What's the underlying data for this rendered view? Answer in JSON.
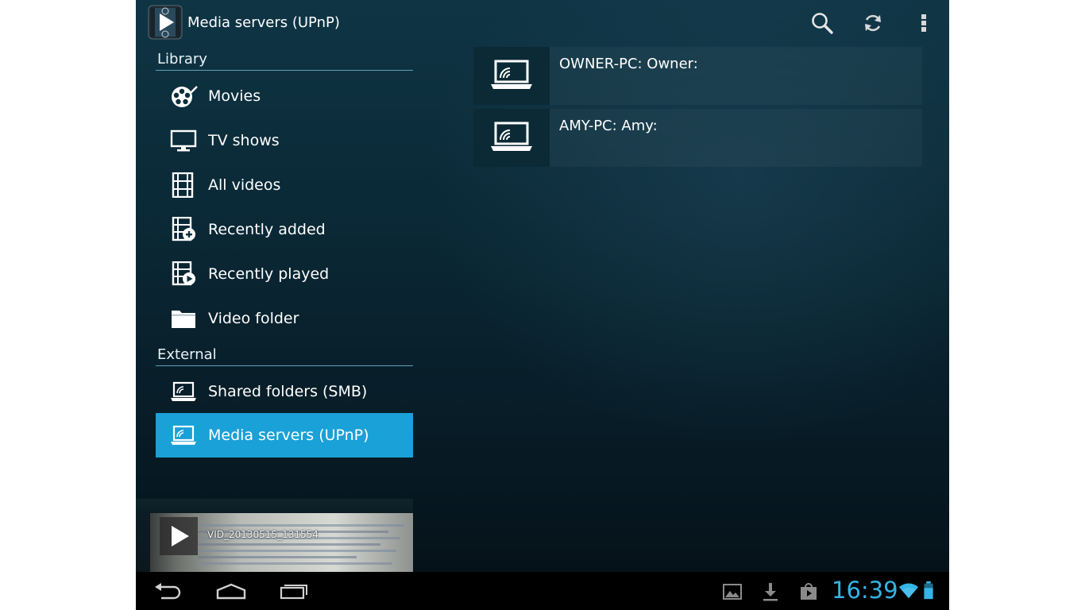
{
  "app": {
    "title": "Media servers (UPnP)"
  },
  "actionbar": {
    "actions": [
      {
        "name": "search",
        "icon": "search-icon"
      },
      {
        "name": "refresh",
        "icon": "refresh-icon"
      },
      {
        "name": "overflow",
        "icon": "overflow-menu-icon"
      }
    ]
  },
  "drawer": {
    "library_header": "Library",
    "library_items": [
      {
        "label": "Movies",
        "icon": "movies-reel-icon"
      },
      {
        "label": "TV shows",
        "icon": "tv-icon"
      },
      {
        "label": "All videos",
        "icon": "film-strip-icon"
      },
      {
        "label": "Recently added",
        "icon": "film-add-icon"
      },
      {
        "label": "Recently played",
        "icon": "film-play-icon"
      },
      {
        "label": "Video folder",
        "icon": "folder-icon"
      }
    ],
    "external_header": "External",
    "external_items": [
      {
        "label": "Shared folders (SMB)",
        "icon": "network-laptop-icon"
      },
      {
        "label": "Media servers (UPnP)",
        "icon": "network-laptop-icon",
        "selected": true
      }
    ]
  },
  "now_playing": {
    "filename": "VID_20130515_131554"
  },
  "servers": [
    {
      "label": "OWNER-PC: Owner:",
      "icon": "network-laptop-icon"
    },
    {
      "label": "AMY-PC: Amy:",
      "icon": "network-laptop-icon"
    }
  ],
  "systembar": {
    "clock": "16:39",
    "accent": "#33b5e5",
    "selected_color": "#1aa1d7"
  }
}
